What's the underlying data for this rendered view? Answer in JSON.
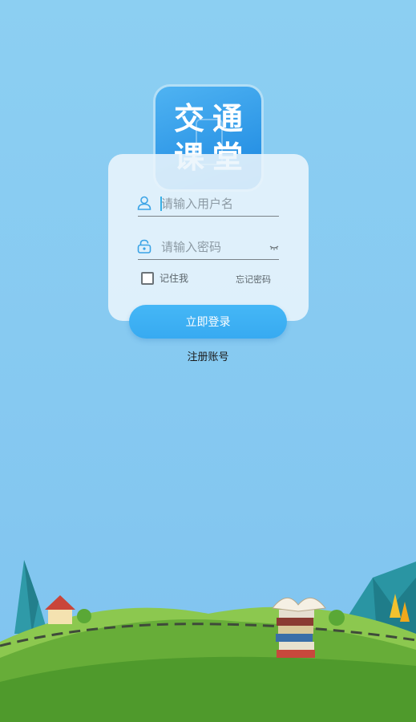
{
  "logo": {
    "line1_a": "交",
    "line1_b": "通",
    "line2_a": "课",
    "line2_b": "堂"
  },
  "login_form": {
    "username_placeholder": "请输入用户名",
    "password_placeholder": "请输入密码",
    "remember_label": "记住我",
    "forgot_label": "忘记密码",
    "remember_checked": false
  },
  "actions": {
    "login_label": "立即登录",
    "register_label": "注册账号"
  },
  "colors": {
    "sky": "#8ccff2",
    "accent": "#3aaef2",
    "hill_dark": "#4f9a2c",
    "hill_light": "#7ec04a"
  },
  "icons": [
    "user-icon",
    "lock-icon",
    "eye-icon",
    "checkbox-icon"
  ]
}
